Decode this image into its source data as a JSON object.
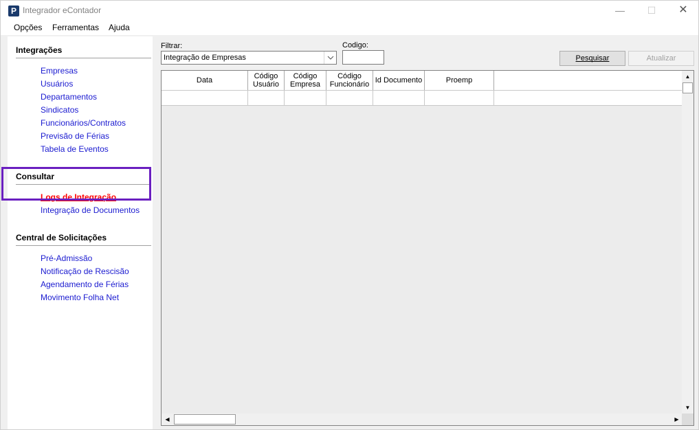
{
  "window": {
    "title": "Integrador eContador",
    "controls": {
      "minimize": "—",
      "maximize": "☐",
      "close": "✕"
    }
  },
  "menu": [
    "Opções",
    "Ferramentas",
    "Ajuda"
  ],
  "sidebar": {
    "sections": [
      {
        "title": "Integrações",
        "items": [
          "Empresas",
          "Usuários",
          "Departamentos",
          "Sindicatos",
          "Funcionários/Contratos",
          "Previsão de Férias",
          "Tabela de Eventos"
        ]
      },
      {
        "title": "Consultar",
        "items": [
          "Logs de Integração",
          "Integração de Documentos"
        ]
      },
      {
        "title": "Central de Solicitações",
        "items": [
          "Pré-Admissão",
          "Notificação de Rescisão",
          "Agendamento de Férias",
          "Movimento Folha Net"
        ]
      }
    ],
    "active_item": "Logs de Integração"
  },
  "filter": {
    "label": "Filtrar:",
    "value": "Integração de Empresas"
  },
  "code": {
    "label": "Codigo:",
    "value": ""
  },
  "buttons": {
    "search": "Pesquisar",
    "update": "Atualizar"
  },
  "grid": {
    "columns": [
      "Data",
      "Código Usuário",
      "Código Empresa",
      "Código Funcionário",
      "Id Documento",
      "Proemp"
    ],
    "rows": []
  },
  "colors": {
    "link": "#1a1ad0",
    "active_link": "#ff0000",
    "highlight": "#6a1fc0"
  }
}
